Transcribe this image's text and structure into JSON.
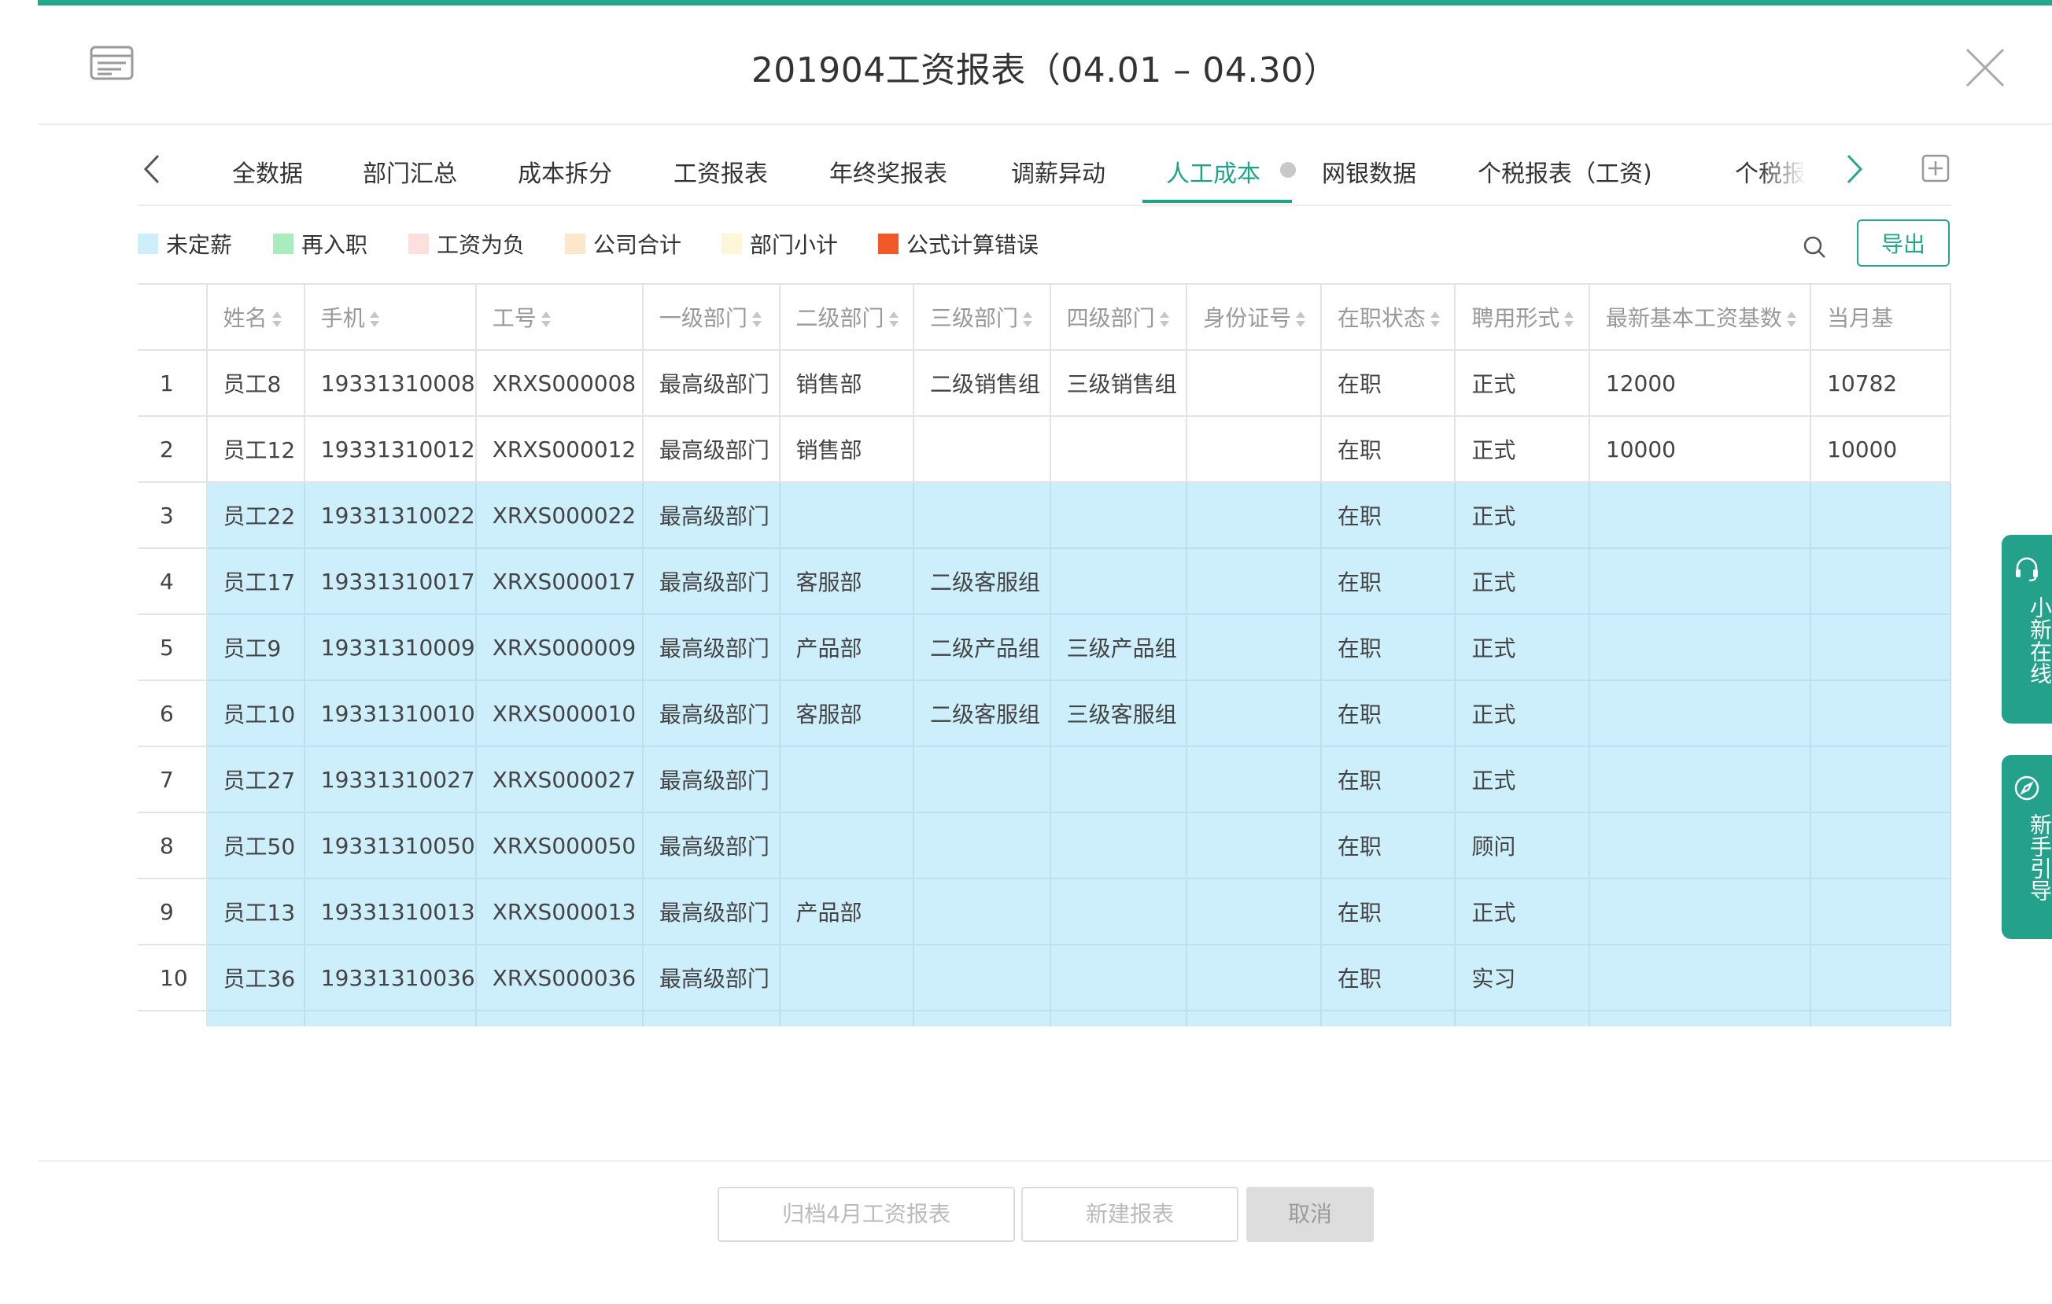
{
  "header": {
    "title": "201904工资报表（04.01 – 04.30）"
  },
  "tabs": [
    {
      "label": "全数据"
    },
    {
      "label": "部门汇总"
    },
    {
      "label": "成本拆分"
    },
    {
      "label": "工资报表"
    },
    {
      "label": "年终奖报表"
    },
    {
      "label": "调薪异动"
    },
    {
      "label": "人工成本",
      "active": true
    },
    {
      "label": "网银数据"
    },
    {
      "label": "个税报表（工资)"
    },
    {
      "label": "个税报"
    }
  ],
  "legend": [
    {
      "label": "未定薪",
      "color": "#cdeefb"
    },
    {
      "label": "再入职",
      "color": "#a9edbf"
    },
    {
      "label": "工资为负",
      "color": "#fde0de"
    },
    {
      "label": "公司合计",
      "color": "#fde7cc"
    },
    {
      "label": "部门小计",
      "color": "#fdf6d8"
    },
    {
      "label": "公式计算错误",
      "color": "#f15a28"
    }
  ],
  "toolbar": {
    "export_label": "导出"
  },
  "table": {
    "columns": [
      "",
      "姓名",
      "手机",
      "工号",
      "一级部门",
      "二级部门",
      "三级部门",
      "四级部门",
      "身份证号",
      "在职状态",
      "聘用形式",
      "最新基本工资基数",
      "当月基"
    ],
    "rows": [
      {
        "cells": [
          "1",
          "员工8",
          "19331310008",
          "XRXS000008",
          "最高级部门",
          "销售部",
          "二级销售组",
          "三级销售组",
          "",
          "在职",
          "正式",
          "12000",
          "10782"
        ],
        "highlight": false
      },
      {
        "cells": [
          "2",
          "员工12",
          "19331310012",
          "XRXS000012",
          "最高级部门",
          "销售部",
          "",
          "",
          "",
          "在职",
          "正式",
          "10000",
          "10000"
        ],
        "highlight": false
      },
      {
        "cells": [
          "3",
          "员工22",
          "19331310022",
          "XRXS000022",
          "最高级部门",
          "",
          "",
          "",
          "",
          "在职",
          "正式",
          "",
          ""
        ],
        "highlight": true
      },
      {
        "cells": [
          "4",
          "员工17",
          "19331310017",
          "XRXS000017",
          "最高级部门",
          "客服部",
          "二级客服组",
          "",
          "",
          "在职",
          "正式",
          "",
          ""
        ],
        "highlight": true
      },
      {
        "cells": [
          "5",
          "员工9",
          "19331310009",
          "XRXS000009",
          "最高级部门",
          "产品部",
          "二级产品组",
          "三级产品组",
          "",
          "在职",
          "正式",
          "",
          ""
        ],
        "highlight": true
      },
      {
        "cells": [
          "6",
          "员工10",
          "19331310010",
          "XRXS000010",
          "最高级部门",
          "客服部",
          "二级客服组",
          "三级客服组",
          "",
          "在职",
          "正式",
          "",
          ""
        ],
        "highlight": true
      },
      {
        "cells": [
          "7",
          "员工27",
          "19331310027",
          "XRXS000027",
          "最高级部门",
          "",
          "",
          "",
          "",
          "在职",
          "正式",
          "",
          ""
        ],
        "highlight": true
      },
      {
        "cells": [
          "8",
          "员工50",
          "19331310050",
          "XRXS000050",
          "最高级部门",
          "",
          "",
          "",
          "",
          "在职",
          "顾问",
          "",
          ""
        ],
        "highlight": true
      },
      {
        "cells": [
          "9",
          "员工13",
          "19331310013",
          "XRXS000013",
          "最高级部门",
          "产品部",
          "",
          "",
          "",
          "在职",
          "正式",
          "",
          ""
        ],
        "highlight": true
      },
      {
        "cells": [
          "10",
          "员工36",
          "19331310036",
          "XRXS000036",
          "最高级部门",
          "",
          "",
          "",
          "",
          "在职",
          "实习",
          "",
          ""
        ],
        "highlight": true
      },
      {
        "cells": [
          "",
          "",
          "",
          "",
          "",
          "",
          "",
          "",
          "",
          "",
          "",
          "",
          ""
        ],
        "highlight": true
      }
    ]
  },
  "side_widgets": [
    {
      "label": "小新在线",
      "icon": "headset-icon"
    },
    {
      "label": "新手引导",
      "icon": "compass-icon"
    }
  ],
  "footer": {
    "archive_label": "归档4月工资报表",
    "new_report_label": "新建报表",
    "cancel_label": "取消"
  },
  "colors": {
    "accent": "#24a88c",
    "row_highlight": "#cdeefb"
  }
}
